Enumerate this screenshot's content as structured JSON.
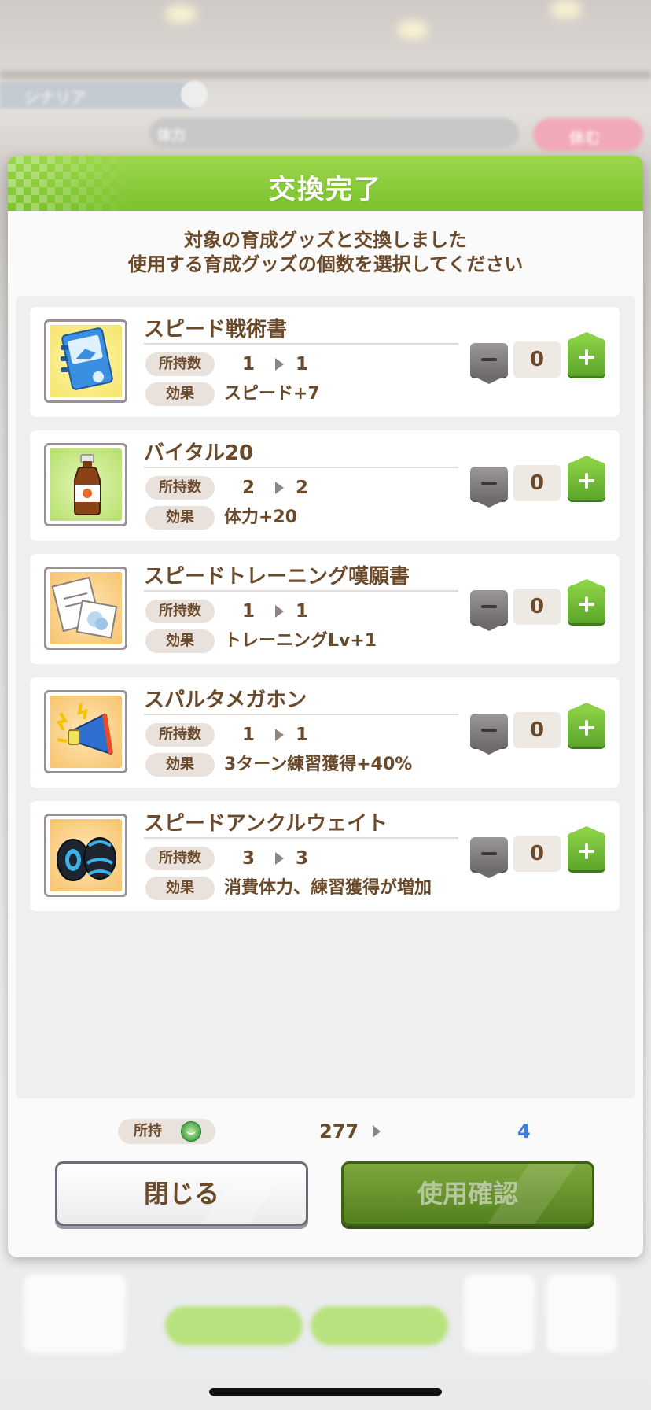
{
  "background": {
    "tag_label": "シナリア",
    "bar_label": "体力",
    "pink_button_label": "休む"
  },
  "dialog": {
    "title": "交換完了",
    "message_line1": "対象の育成グッズと交換しました",
    "message_line2": "使用する育成グッズの個数を選択してください",
    "owned_label": "所持数",
    "effect_label": "効果",
    "items": [
      {
        "name": "スピード戦術書",
        "icon": "book-icon",
        "owned_from": "1",
        "owned_to": "1",
        "effect": "スピード+7",
        "quantity": "0"
      },
      {
        "name": "バイタル20",
        "icon": "bottle-icon",
        "owned_from": "2",
        "owned_to": "2",
        "effect": "体力+20",
        "quantity": "0"
      },
      {
        "name": "スピードトレーニング嘆願書",
        "icon": "petition-icon",
        "owned_from": "1",
        "owned_to": "1",
        "effect": "トレーニングLv+1",
        "quantity": "0"
      },
      {
        "name": "スパルタメガホン",
        "icon": "megaphone-icon",
        "owned_from": "1",
        "owned_to": "1",
        "effect": "3ターン練習獲得+40%",
        "quantity": "0"
      },
      {
        "name": "スピードアンクルウェイト",
        "icon": "ankle-weight-icon",
        "owned_from": "3",
        "owned_to": "3",
        "effect": "消費体力、練習獲得が増加",
        "quantity": "0"
      }
    ],
    "footer": {
      "owned_label": "所持",
      "coin_icon": "coin-icon",
      "balance_before": "277",
      "balance_after": "4"
    },
    "buttons": {
      "close": "閉じる",
      "confirm": "使用確認"
    }
  },
  "colors": {
    "header_green": "#7cc22e",
    "text_brown": "#6b4a2b",
    "plus_green": "#5ba52a",
    "balance_blue": "#3b7ee0"
  }
}
